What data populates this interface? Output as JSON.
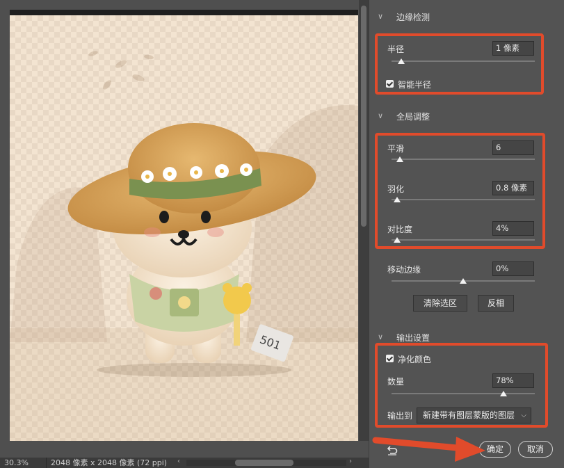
{
  "status": {
    "zoom": "30.3%",
    "dimensions": "2048 像素 x 2048 像素 (72 ppi)",
    "left_arrow": "‹",
    "right_arrow": "›"
  },
  "canvas": {
    "tag_text": "501"
  },
  "edge_detection": {
    "title": "边缘检测",
    "radius_label": "半径",
    "radius_value": "1 像素",
    "smart_radius_label": "智能半径"
  },
  "global_refine": {
    "title": "全局调整",
    "smooth_label": "平滑",
    "smooth_value": "6",
    "feather_label": "羽化",
    "feather_value": "0.8 像素",
    "contrast_label": "对比度",
    "contrast_value": "4%",
    "shift_edge_label": "移动边缘",
    "shift_edge_value": "0%",
    "clear_selection_label": "清除选区",
    "invert_label": "反相"
  },
  "output": {
    "title": "输出设置",
    "decontaminate_label": "净化颜色",
    "amount_label": "数量",
    "amount_value": "78%",
    "output_to_label": "输出到",
    "output_to_value": "新建带有图层蒙版的图层"
  },
  "footer": {
    "ok_label": "确定",
    "cancel_label": "取消"
  },
  "sliders": {
    "radius": 0.07,
    "smooth": 0.06,
    "feather": 0.04,
    "contrast": 0.04,
    "shift_edge": 0.5,
    "amount": 0.78
  },
  "colors": {
    "highlight": "#e14b2b",
    "panel_bg": "#535353"
  }
}
